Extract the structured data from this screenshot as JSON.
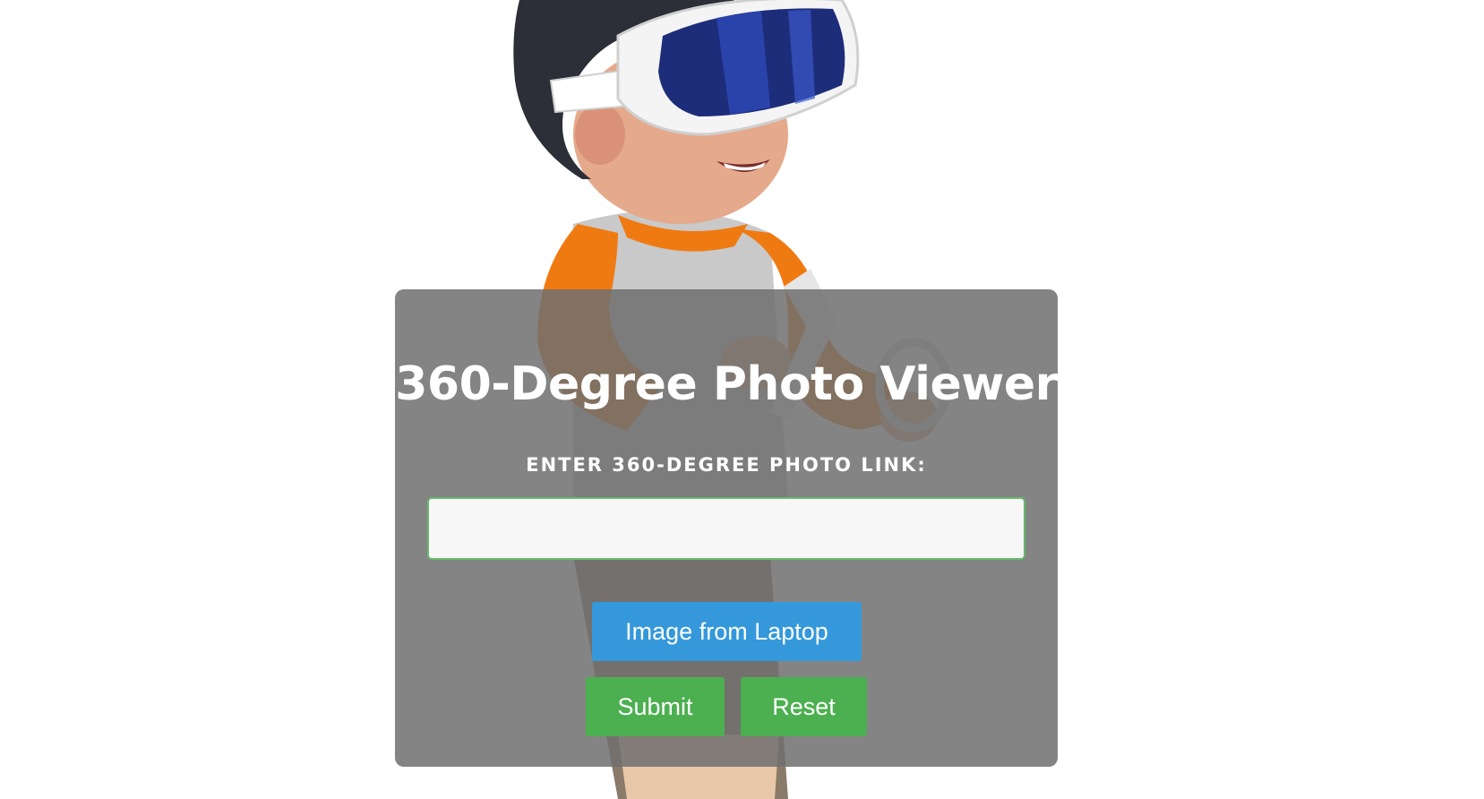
{
  "viewer": {
    "title": "360-Degree Photo Viewer",
    "link_label": "ENTER 360-DEGREE PHOTO LINK:",
    "link_input_value": "",
    "link_input_placeholder": "",
    "laptop_button_label": "Image from Laptop",
    "submit_button_label": "Submit",
    "reset_button_label": "Reset"
  },
  "colors": {
    "panel_overlay": "#6e6e6e",
    "laptop_button": "#3498db",
    "submit_button": "#4caf50",
    "reset_button": "#4caf50",
    "input_border": "#66bb6a"
  },
  "background": {
    "illustration": "vr-headset-kid-icon"
  }
}
